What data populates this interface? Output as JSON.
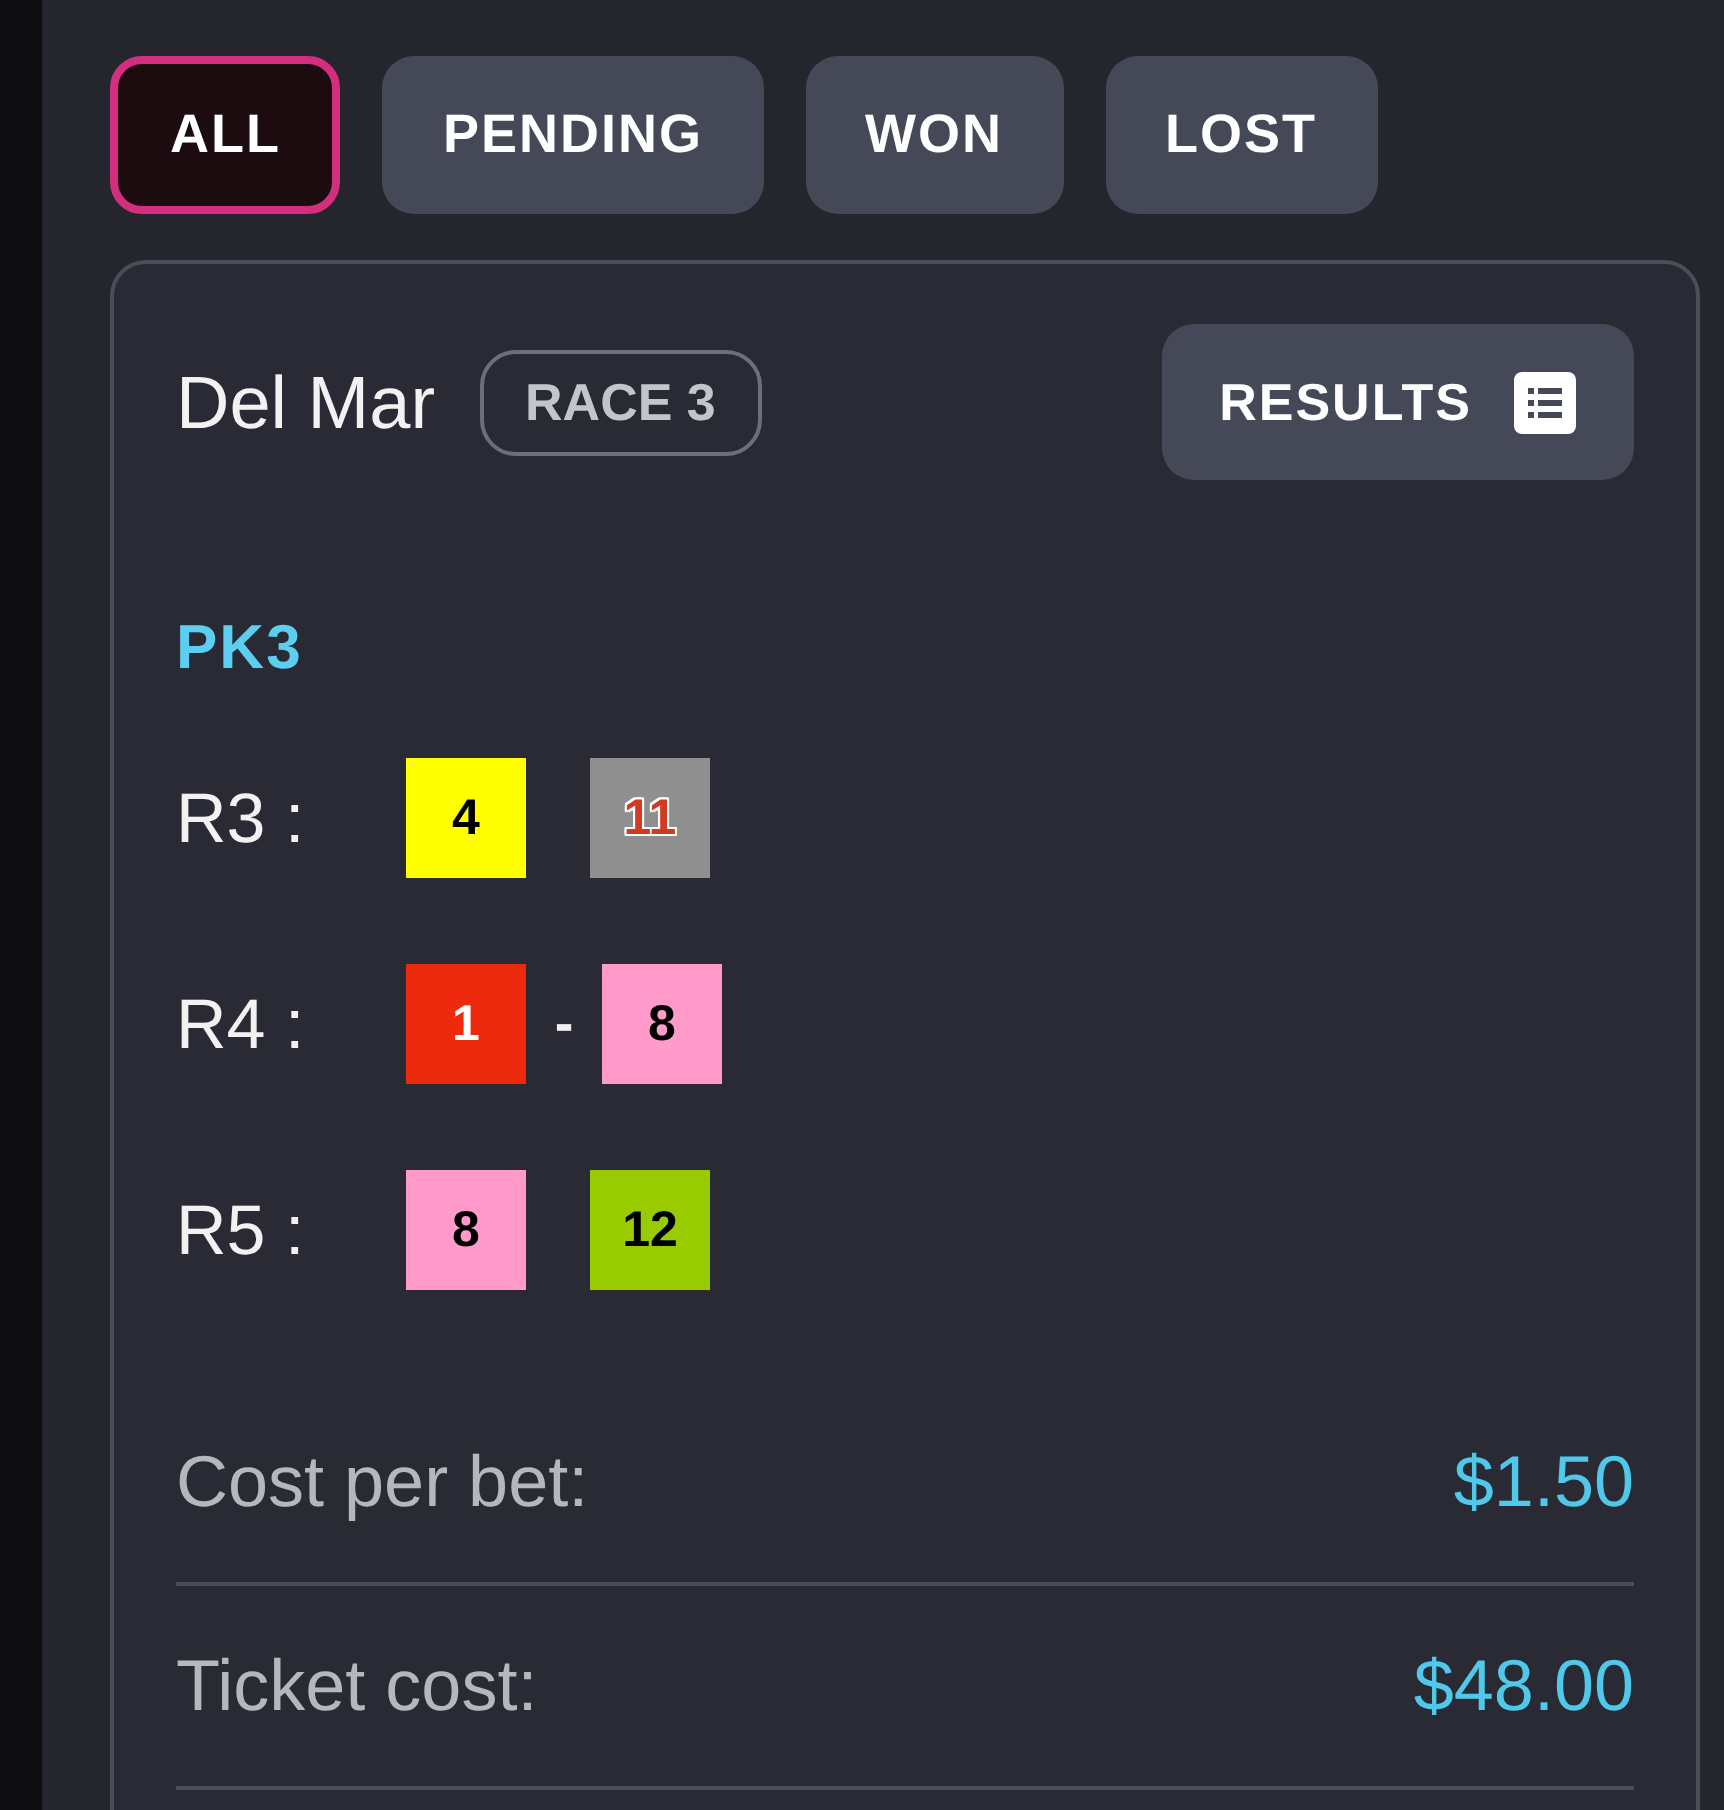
{
  "filter_tabs": [
    {
      "label": "ALL",
      "selected": true
    },
    {
      "label": "PENDING",
      "selected": false
    },
    {
      "label": "WON",
      "selected": false
    },
    {
      "label": "LOST",
      "selected": false
    }
  ],
  "ticket": {
    "track": "Del Mar",
    "race_badge": "RACE 3",
    "results_button": "RESULTS",
    "bet_type": "PK3",
    "legs": [
      {
        "label": "R3 :",
        "items": [
          {
            "kind": "saddle",
            "color": "#ffff00",
            "number": {
              "text": "4",
              "color": "#000000",
              "outlined": false
            }
          },
          {
            "kind": "saddle",
            "color": "#8f8f8f",
            "number": {
              "text": "11",
              "color": "#d23a22",
              "outlined": true
            }
          }
        ]
      },
      {
        "label": "R4 :",
        "items": [
          {
            "kind": "saddle",
            "color": "#ee2a0e",
            "number": {
              "text": "1",
              "color": "#ffffff",
              "outlined": false
            }
          },
          {
            "kind": "dash",
            "text": "-"
          },
          {
            "kind": "saddle",
            "color": "#ff9acb",
            "number": {
              "text": "8",
              "color": "#000000",
              "outlined": false
            }
          }
        ]
      },
      {
        "label": "R5 :",
        "items": [
          {
            "kind": "saddle",
            "color": "#ff9acb",
            "number": {
              "text": "8",
              "color": "#000000",
              "outlined": false
            }
          },
          {
            "kind": "saddle",
            "color": "#99cc00",
            "number": {
              "text": "12",
              "color": "#000000",
              "outlined": false
            }
          }
        ]
      }
    ],
    "costs": [
      {
        "label": "Cost per bet:",
        "value": "$1.50"
      },
      {
        "label": "Ticket cost:",
        "value": "$48.00"
      }
    ]
  }
}
